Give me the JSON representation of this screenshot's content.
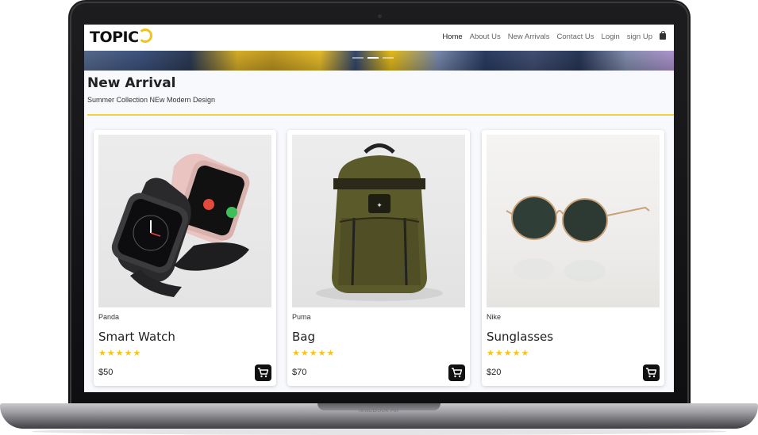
{
  "device": {
    "label": "MacBook Air"
  },
  "nav": {
    "logo": "TOPIC",
    "links": [
      "Home",
      "About Us",
      "New Arrivals",
      "Contact Us",
      "Login",
      "sign Up"
    ],
    "active": "Home",
    "cart_icon": "shopping-bag-icon"
  },
  "section": {
    "title": "New Arrival",
    "subtitle": "Summer Collection NEw Modern Design"
  },
  "products": [
    {
      "brand": "Panda",
      "name": "Smart Watch",
      "rating": "★★★★★",
      "price": "$50",
      "icon": "cart-icon"
    },
    {
      "brand": "Puma",
      "name": "Bag",
      "rating": "★★★★★",
      "price": "$70",
      "icon": "cart-icon"
    },
    {
      "brand": "Nike",
      "name": "Sunglasses",
      "rating": "★★★★★",
      "price": "$20",
      "icon": "cart-icon"
    }
  ],
  "colors": {
    "accent": "#f0c419",
    "star": "#f5c518",
    "cart_button": "#111111"
  }
}
